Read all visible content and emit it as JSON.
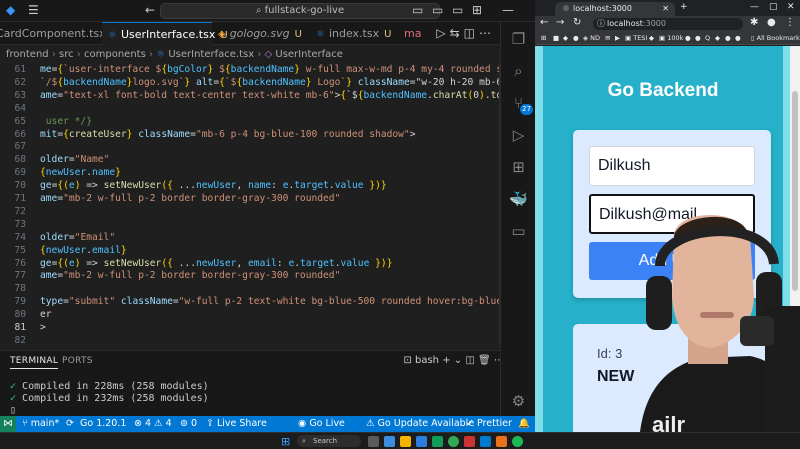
{
  "vscode": {
    "command_center": "fullstack-go-live",
    "tabs": [
      {
        "label": "CardComponent.tsx",
        "status": "U",
        "icon": "TS"
      },
      {
        "label": "UserInterface.tsx",
        "status": "U",
        "icon": "TS"
      },
      {
        "label": "gologo.svg",
        "status": "U",
        "icon": "SVG"
      },
      {
        "label": "index.tsx",
        "status": "U",
        "icon": "TS"
      },
      {
        "label": "ma",
        "status": "",
        "icon": "TS"
      }
    ],
    "breadcrumb": [
      "frontend",
      "src",
      "components",
      "UserInterface.tsx",
      "UserInterface"
    ],
    "code_lines": [
      {
        "n": "61",
        "text": "me={`user-interface ${bgColor} ${backendName} w-full max-w-md p-4 my-4 rounded shadow`}>"
      },
      {
        "n": "62",
        "text": "`/${backendName}logo.svg`} alt={`${backendName} Logo`} className=\"w-20 h-20 mb-6 mx-auto"
      },
      {
        "n": "63",
        "text": "ame=\"text-xl font-bold text-center text-white mb-6\">{`${backendName.charAt(0).toUpperCas"
      },
      {
        "n": "64",
        "text": ""
      },
      {
        "n": "65",
        "text": " user */}"
      },
      {
        "n": "66",
        "text": "mit={createUser} className=\"mb-6 p-4 bg-blue-100 rounded shadow\">"
      },
      {
        "n": "67",
        "text": ""
      },
      {
        "n": "68",
        "text": "older=\"Name\""
      },
      {
        "n": "69",
        "text": "{newUser.name}"
      },
      {
        "n": "70",
        "text": "ge={(e) => setNewUser({ ...newUser, name: e.target.value })}"
      },
      {
        "n": "71",
        "text": "ame=\"mb-2 w-full p-2 border border-gray-300 rounded\""
      },
      {
        "n": "72",
        "text": ""
      },
      {
        "n": "73",
        "text": ""
      },
      {
        "n": "74",
        "text": "older=\"Email\""
      },
      {
        "n": "75",
        "text": "{newUser.email}"
      },
      {
        "n": "76",
        "text": "ge={(e) => setNewUser({ ...newUser, email: e.target.value })}"
      },
      {
        "n": "77",
        "text": "ame=\"mb-2 w-full p-2 border border-gray-300 rounded\""
      },
      {
        "n": "78",
        "text": ""
      },
      {
        "n": "79",
        "text": "type=\"submit\" className=\"w-full p-2 text-white bg-blue-500 rounded hover:bg-blue-600\">"
      },
      {
        "n": "80",
        "text": "er"
      },
      {
        "n": "81",
        "text": ">"
      },
      {
        "n": "82",
        "text": ""
      }
    ],
    "panel": {
      "tab_terminal": "TERMINAL",
      "tab_ports": "PORTS",
      "shell": "bash",
      "lines": [
        "Compiled in 228ms (258 modules)",
        "Compiled in 232ms (258 modules)"
      ]
    },
    "statusbar": {
      "branch": "main*",
      "go_version": "Go 1.20.1",
      "errors": "4",
      "warnings": "4",
      "ports": "0",
      "live_share": "Live Share",
      "go_live": "Go Live",
      "go_update": "Go Update Available",
      "prettier": "Prettier"
    },
    "activity_badge": "27"
  },
  "browser": {
    "tab_title": "localhost:3000",
    "url_host": "localhost",
    "url_port": ":3000",
    "bookmarks": [
      "ND",
      "TESI",
      "100k",
      "Q",
      "All Bookmarks"
    ],
    "page_title": "Go Backend",
    "name_value": "Dilkush",
    "email_value": "Dilkush@mail",
    "add_button": "Add User",
    "user_id": "Id: 3",
    "user_name": "NEW"
  },
  "taskbar": {
    "search_placeholder": "Search"
  }
}
